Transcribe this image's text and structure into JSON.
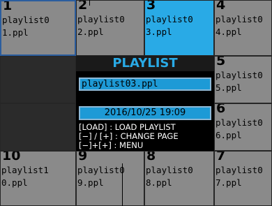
{
  "grid": {
    "cells": [
      {
        "num": "1",
        "file": "playlist0\n1.ppl",
        "state": "current"
      },
      {
        "num": "2",
        "file": "playlist0\n2.ppl",
        "state": "normal"
      },
      {
        "num": "3",
        "file": "playlist0\n3.ppl",
        "state": "selected"
      },
      {
        "num": "4",
        "file": "playlist0\n4.ppl",
        "state": "normal"
      },
      {
        "num": "5",
        "file": "playlist0\n5.ppl",
        "state": "normal"
      },
      {
        "num": "6",
        "file": "playlist0\n6.ppl",
        "state": "normal"
      },
      {
        "num": "7",
        "file": "playlist0\n7.ppl",
        "state": "normal"
      },
      {
        "num": "8",
        "file": "playlist0\n8.ppl",
        "state": "normal"
      },
      {
        "num": "9",
        "file": "playlist0\n9.ppl",
        "state": "normal"
      },
      {
        "num": "10",
        "file": "playlist1\n0.ppl",
        "state": "normal"
      }
    ]
  },
  "panel": {
    "title": "PLAYLIST",
    "selected_file": "playlist03.ppl",
    "date": "2016/10/25  19:09",
    "help": {
      "load": "[LOAD] : LOAD PLAYLIST",
      "page": "[−] / [+] : CHANGE PAGE",
      "menu": "[−]+[+] : MENU"
    }
  },
  "colors": {
    "selected": "#29aae6",
    "normal": "#8a8a8a",
    "title": "#29aae6"
  }
}
